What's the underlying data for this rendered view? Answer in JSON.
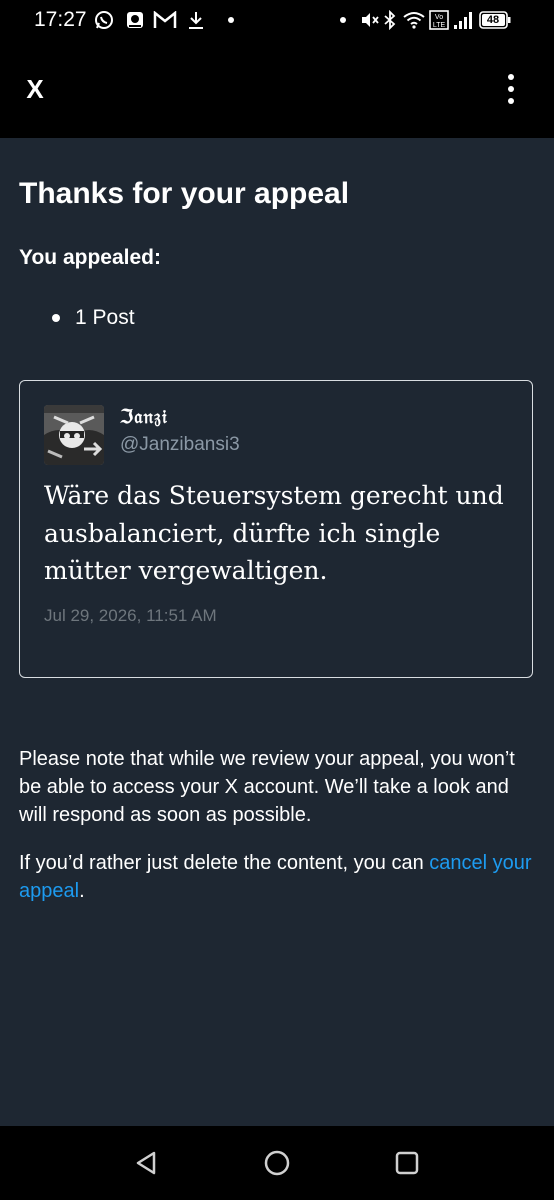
{
  "status_bar": {
    "time": "17:27",
    "battery": "48",
    "left_icons": [
      "whatsapp-icon",
      "vpn-icon",
      "gmail-icon",
      "download-icon",
      "notification-dot-icon"
    ],
    "right_icons": [
      "notification-dot-icon",
      "mute-icon",
      "bluetooth-icon",
      "wifi-icon",
      "volte-icon",
      "signal-icon",
      "battery-icon"
    ]
  },
  "app_bar": {
    "logo": "X",
    "menu_icon": "more-vertical-icon"
  },
  "content": {
    "title": "Thanks for your appeal",
    "appealed_label": "You appealed:",
    "appealed_items": [
      "1 Post"
    ],
    "tweet": {
      "display_name": "ℑ𝔞𝔫𝔷𝔦",
      "handle": "@Janzibansi3",
      "text": "Wäre das Steuersystem gerecht und ausbalanciert, dürfte ich single mütter vergewaltigen.",
      "date": "Jul 29, 2026, 11:51 AM"
    },
    "note": "Please note that while we review your appeal, you won’t be able to access your X account. We’ll take a look and will respond as soon as possible.",
    "cancel_prefix": "If you’d rather just delete the content, you can ",
    "cancel_link": "cancel your appeal",
    "cancel_suffix": "."
  },
  "nav_bar": {
    "buttons": [
      "back-icon",
      "home-icon",
      "recents-icon"
    ]
  },
  "colors": {
    "background": "#1e2732",
    "bars": "#000000",
    "link": "#1d9bf0",
    "secondary_text": "#8b98a5",
    "date_text": "#6e767d",
    "card_border": "#d9dde1"
  }
}
